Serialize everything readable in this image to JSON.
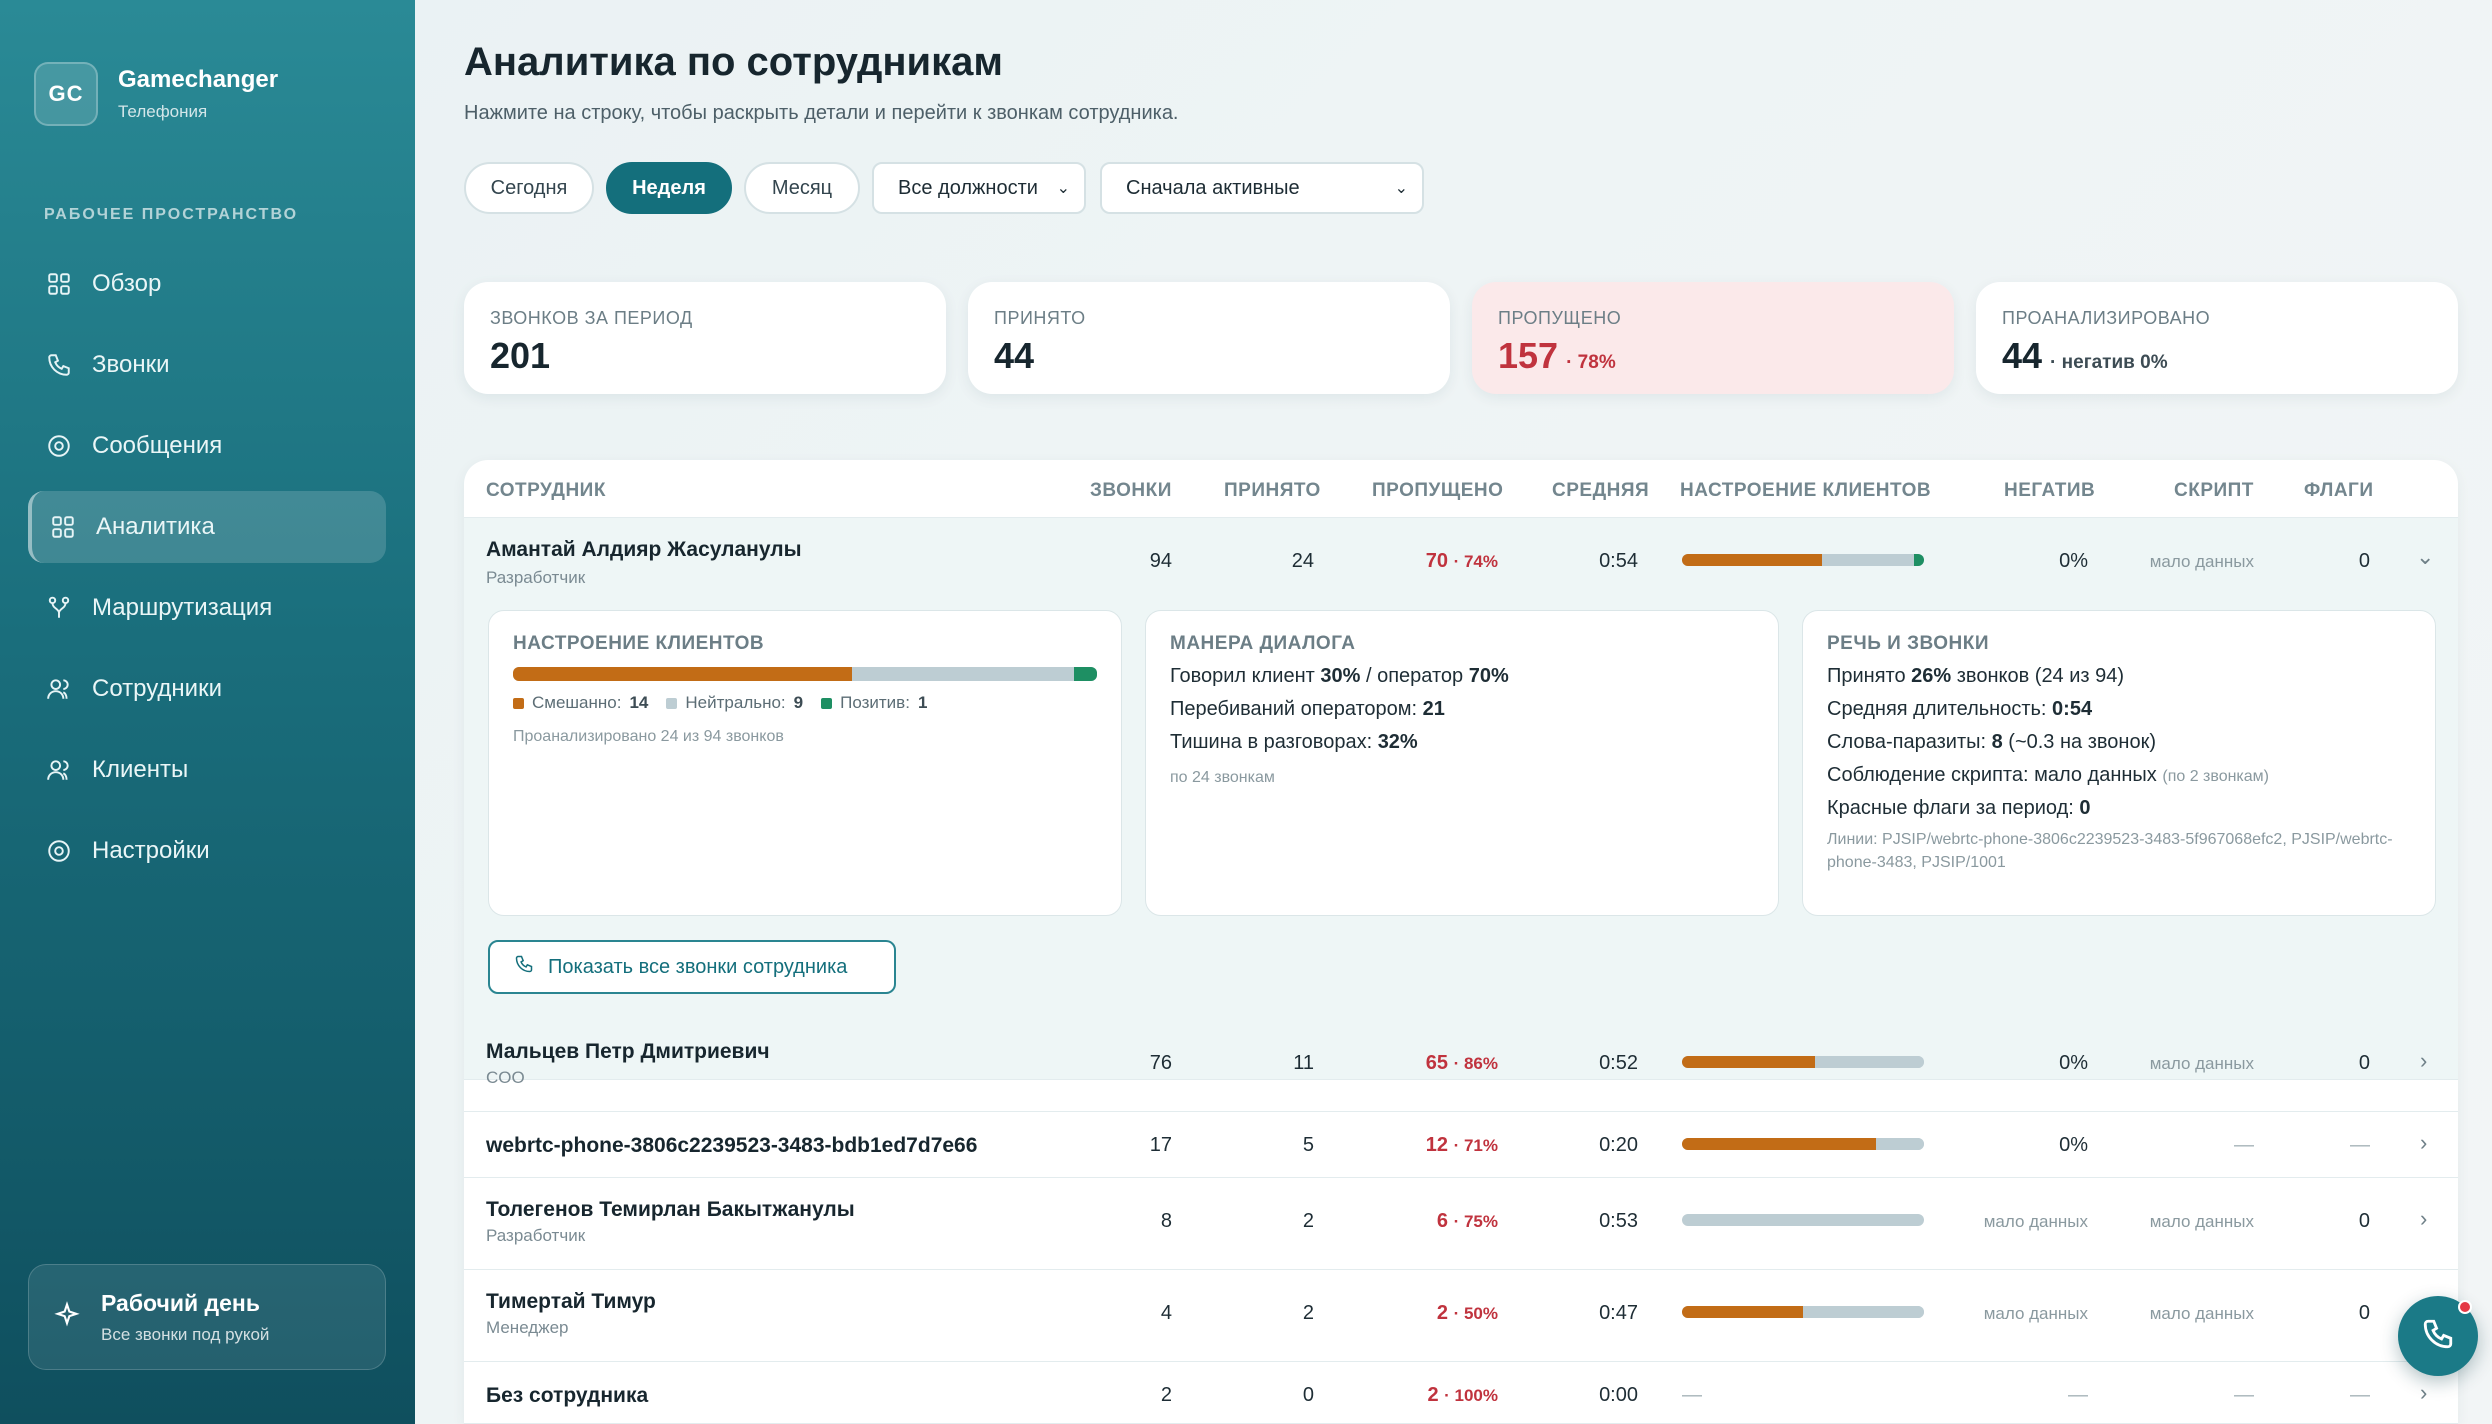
{
  "brand": {
    "logo": "GC",
    "name": "Gamechanger",
    "subtitle": "Телефония"
  },
  "sidebar": {
    "section_label": "РАБОЧЕЕ ПРОСТРАНСТВО",
    "items": [
      {
        "label": "Обзор",
        "icon": "grid-icon"
      },
      {
        "label": "Звонки",
        "icon": "phone-icon"
      },
      {
        "label": "Сообщения",
        "icon": "message-icon"
      },
      {
        "label": "Аналитика",
        "icon": "grid-icon",
        "active": true
      },
      {
        "label": "Маршрутизация",
        "icon": "routing-icon"
      },
      {
        "label": "Сотрудники",
        "icon": "users-icon"
      },
      {
        "label": "Клиенты",
        "icon": "users-icon"
      },
      {
        "label": "Настройки",
        "icon": "gear-icon"
      }
    ],
    "workday": {
      "title": "Рабочий день",
      "subtitle": "Все звонки под рукой",
      "icon": "sparkle-icon"
    }
  },
  "page": {
    "title": "Аналитика по сотрудникам",
    "subtitle": "Нажмите на строку, чтобы раскрыть детали и перейти к звонкам сотрудника."
  },
  "filters": {
    "periods": [
      "Сегодня",
      "Неделя",
      "Месяц"
    ],
    "active_period": "Неделя",
    "role_select": "Все должности",
    "sort_select": "Сначала активные"
  },
  "stats": {
    "calls": {
      "label": "ЗВОНКОВ ЗА ПЕРИОД",
      "value": "201"
    },
    "accepted": {
      "label": "ПРИНЯТО",
      "value": "44"
    },
    "missed": {
      "label": "ПРОПУЩЕНО",
      "value": "157",
      "note": "· 78%"
    },
    "analyzed": {
      "label": "ПРОАНАЛИЗИРОВАНО",
      "value": "44",
      "note": "· негатив 0%"
    }
  },
  "table": {
    "headers": {
      "employee": "СОТРУДНИК",
      "calls": "ЗВОНКИ",
      "accepted": "ПРИНЯТО",
      "missed": "ПРОПУЩЕНО",
      "avg": "СРЕДНЯЯ",
      "mood": "НАСТРОЕНИЕ КЛИЕНТОВ",
      "negative": "НЕГАТИВ",
      "script": "СКРИПТ",
      "flags": "ФЛАГИ"
    },
    "rows": [
      {
        "name": "Амантай Алдияр Жасуланулы",
        "role": "Разработчик",
        "calls": "94",
        "accepted": "24",
        "missed": "70",
        "missed_pct": "· 74%",
        "avg": "0:54",
        "mood": [
          0.58,
          0.38,
          0.04
        ],
        "negative": "0%",
        "script": "мало данных",
        "flags": "0",
        "expanded": true
      },
      {
        "name": "Мальцев Петр Дмитриевич",
        "role": "COO",
        "calls": "76",
        "accepted": "11",
        "missed": "65",
        "missed_pct": "· 86%",
        "avg": "0:52",
        "mood": [
          0.55,
          0.45,
          0
        ],
        "negative": "0%",
        "script": "мало данных",
        "flags": "0"
      },
      {
        "name": "webrtc-phone-3806c2239523-3483-bdb1ed7d7e66",
        "role": "",
        "calls": "17",
        "accepted": "5",
        "missed": "12",
        "missed_pct": "· 71%",
        "avg": "0:20",
        "mood": [
          0.8,
          0.2,
          0
        ],
        "negative": "0%",
        "script": "—",
        "flags": "—"
      },
      {
        "name": "Толегенов Темирлан Бакытжанулы",
        "role": "Разработчик",
        "calls": "8",
        "accepted": "2",
        "missed": "6",
        "missed_pct": "· 75%",
        "avg": "0:53",
        "mood": [
          0,
          1,
          0
        ],
        "negative": "мало данных",
        "script": "мало данных",
        "flags": "0"
      },
      {
        "name": "Тимертай Тимур",
        "role": "Менеджер",
        "calls": "4",
        "accepted": "2",
        "missed": "2",
        "missed_pct": "· 50%",
        "avg": "0:47",
        "mood": [
          0.5,
          0.5,
          0
        ],
        "negative": "мало данных",
        "script": "мало данных",
        "flags": "0"
      },
      {
        "name": "Без сотрудника",
        "role": "",
        "calls": "2",
        "accepted": "0",
        "missed": "2",
        "missed_pct": "· 100%",
        "avg": "0:00",
        "mood_text": "—",
        "negative": "—",
        "script": "—",
        "flags": "—"
      }
    ]
  },
  "detail": {
    "mood": {
      "title": "НАСТРОЕНИЕ КЛИЕНТОВ",
      "bar": [
        0.58,
        0.38,
        0.04
      ],
      "legend": [
        {
          "label": "Смешанно:",
          "value": "14",
          "color": "#c26c16"
        },
        {
          "label": "Нейтрально:",
          "value": "9",
          "color": "#bdcdd3"
        },
        {
          "label": "Позитив:",
          "value": "1",
          "color": "#1e8f63"
        }
      ],
      "note": "Проанализировано 24 из 94 звонков"
    },
    "manner": {
      "title": "МАНЕРА ДИАЛОГА",
      "l1a": "Говорил клиент ",
      "l1b": "30%",
      "l1c": " / оператор ",
      "l1d": "70%",
      "l2a": "Перебиваний оператором: ",
      "l2b": "21",
      "l3a": "Тишина в разговорах: ",
      "l3b": "32%",
      "note": "по 24 звонкам"
    },
    "speech": {
      "title": "РЕЧЬ И ЗВОНКИ",
      "l1a": "Принято ",
      "l1b": "26%",
      "l1c": " звонков (24 из 94)",
      "l2a": "Средняя длительность: ",
      "l2b": "0:54",
      "l3a": "Слова-паразиты: ",
      "l3b": "8",
      "l3c": " (~0.3 на звонок)",
      "l4a": "Соблюдение скрипта: мало данных ",
      "l4b": "(по 2 звонкам)",
      "l5a": "Красные флаги за период: ",
      "l5b": "0",
      "lines": "Линии: PJSIP/webrtc-phone-3806c2239523-3483-5f967068efc2, PJSIP/webrtc-phone-3483, PJSIP/1001"
    },
    "show_calls": "Показать все звонки сотрудника"
  }
}
